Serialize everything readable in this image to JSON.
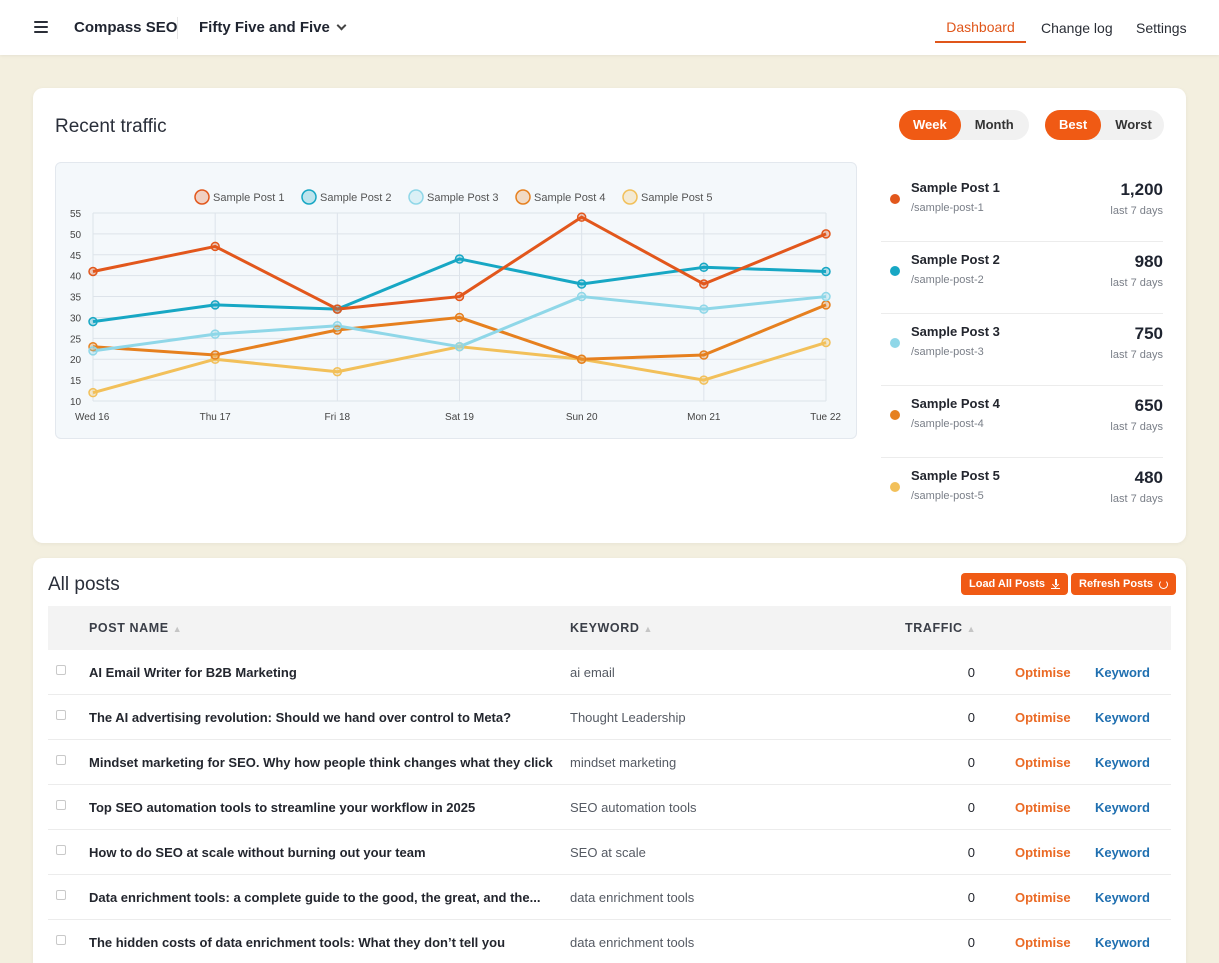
{
  "header": {
    "app_title": "Compass SEO",
    "site_name": "Fifty Five and Five",
    "nav": {
      "dashboard": "Dashboard",
      "changelog": "Change log",
      "settings": "Settings"
    }
  },
  "traffic": {
    "title": "Recent traffic",
    "range_options": {
      "week": "Week",
      "month": "Month",
      "selected": "Week"
    },
    "sort_options": {
      "best": "Best",
      "worst": "Worst",
      "selected": "Best"
    },
    "top_posts": [
      {
        "name": "Sample Post 1",
        "slug": "/sample-post-1",
        "value": "1,200",
        "period": "last 7 days",
        "color": "#e2571c"
      },
      {
        "name": "Sample Post 2",
        "slug": "/sample-post-2",
        "value": "980",
        "period": "last 7 days",
        "color": "#17a7c4"
      },
      {
        "name": "Sample Post 3",
        "slug": "/sample-post-3",
        "value": "750",
        "period": "last 7 days",
        "color": "#8fd7e8"
      },
      {
        "name": "Sample Post 4",
        "slug": "/sample-post-4",
        "value": "650",
        "period": "last 7 days",
        "color": "#e6801f"
      },
      {
        "name": "Sample Post 5",
        "slug": "/sample-post-5",
        "value": "480",
        "period": "last 7 days",
        "color": "#f2c05a"
      }
    ]
  },
  "chart_data": {
    "type": "line",
    "x": [
      "Wed 16",
      "Thu 17",
      "Fri 18",
      "Sat 19",
      "Sun 20",
      "Mon 21",
      "Tue 22"
    ],
    "ylim": [
      10,
      55
    ],
    "yticks": [
      10,
      15,
      20,
      25,
      30,
      35,
      40,
      45,
      50,
      55
    ],
    "grid": true,
    "legend": "top",
    "series": [
      {
        "name": "Sample Post 1",
        "color": "#e2571c",
        "values": [
          41,
          47,
          32,
          35,
          54,
          38,
          50
        ]
      },
      {
        "name": "Sample Post 2",
        "color": "#17a7c4",
        "values": [
          29,
          33,
          32,
          44,
          38,
          42,
          41
        ]
      },
      {
        "name": "Sample Post 3",
        "color": "#8fd7e8",
        "values": [
          22,
          26,
          28,
          23,
          35,
          32,
          35
        ]
      },
      {
        "name": "Sample Post 4",
        "color": "#e6801f",
        "values": [
          23,
          21,
          27,
          30,
          20,
          21,
          33
        ]
      },
      {
        "name": "Sample Post 5",
        "color": "#f2c05a",
        "values": [
          12,
          20,
          17,
          23,
          20,
          15,
          24
        ]
      }
    ]
  },
  "posts": {
    "title": "All posts",
    "load_all_label": "Load All Posts",
    "refresh_label": "Refresh Posts",
    "columns": {
      "name": "POST NAME",
      "keyword": "KEYWORD",
      "traffic": "TRAFFIC"
    },
    "rows": [
      {
        "name": "AI Email Writer for B2B Marketing",
        "keyword": "ai email",
        "traffic": "0",
        "optimise": "Optimise",
        "keyword_link": "Keyword"
      },
      {
        "name": "The AI advertising revolution: Should we hand over control to Meta?",
        "keyword": "Thought Leadership",
        "traffic": "0",
        "optimise": "Optimise",
        "keyword_link": "Keyword"
      },
      {
        "name": "Mindset marketing for SEO. Why how people think changes what they click",
        "keyword": "mindset marketing",
        "traffic": "0",
        "optimise": "Optimise",
        "keyword_link": "Keyword"
      },
      {
        "name": "Top SEO automation tools to streamline your workflow in 2025",
        "keyword": "SEO automation tools",
        "traffic": "0",
        "optimise": "Optimise",
        "keyword_link": "Keyword"
      },
      {
        "name": "How to do SEO at scale without burning out your team",
        "keyword": "SEO at scale",
        "traffic": "0",
        "optimise": "Optimise",
        "keyword_link": "Keyword"
      },
      {
        "name": "Data enrichment tools: a complete guide to the good, the great, and the...",
        "keyword": "data enrichment tools",
        "traffic": "0",
        "optimise": "Optimise",
        "keyword_link": "Keyword"
      },
      {
        "name": "The hidden costs of data enrichment tools: What they don’t tell you",
        "keyword": "data enrichment tools",
        "traffic": "0",
        "optimise": "Optimise",
        "keyword_link": "Keyword"
      }
    ]
  }
}
